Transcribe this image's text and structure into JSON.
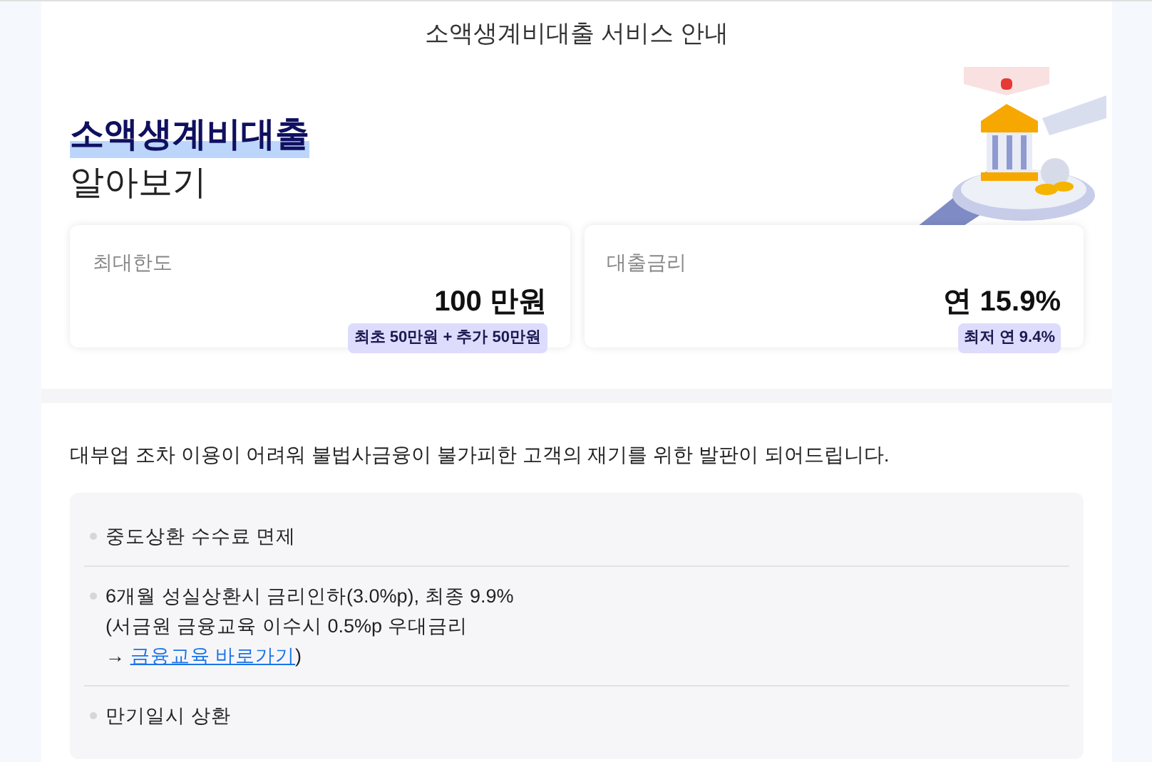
{
  "header": {
    "title": "소액생계비대출 서비스 안내"
  },
  "hero": {
    "title_highlight": "소액생계비대출",
    "title_rest": "알아보기"
  },
  "cards": [
    {
      "label": "최대한도",
      "value": "100 만원",
      "badge": "최초 50만원 + 추가 50만원"
    },
    {
      "label": "대출금리",
      "value": "연 15.9%",
      "badge": "최저 연 9.4%"
    }
  ],
  "intro": "대부업 조차 이용이 어려워 불법사금융이 불가피한 고객의 재기를 위한 발판이 되어드립니다.",
  "features": [
    {
      "lines": [
        "중도상환 수수료 면제"
      ]
    },
    {
      "lines": [
        "6개월 성실상환시 금리인하(3.0%p), 최종 9.9%",
        "(서금원 금융교육 이수시 0.5%p 우대금리"
      ],
      "link_prefix": "→ ",
      "link": "금융교육 바로가기",
      "link_suffix": ")"
    },
    {
      "lines": [
        "만기일시 상환"
      ]
    }
  ]
}
